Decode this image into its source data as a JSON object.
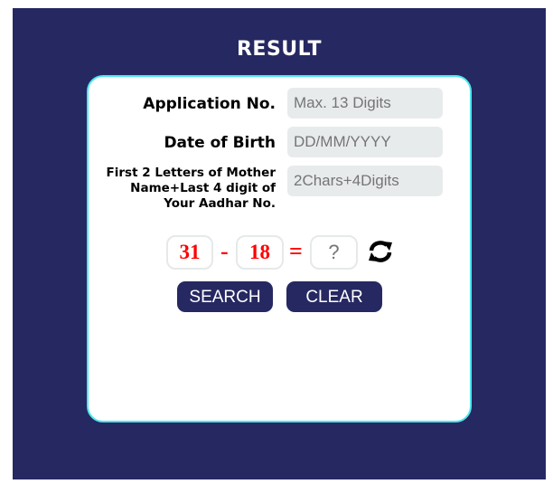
{
  "header": {
    "title": "RESULT"
  },
  "form": {
    "application_no": {
      "label": "Application No.",
      "placeholder": "Max. 13 Digits",
      "value": ""
    },
    "dob": {
      "label": "Date of Birth",
      "placeholder": "DD/MM/YYYY",
      "value": ""
    },
    "mother_aadhar": {
      "label": "First 2 Letters of Mother Name+Last 4 digit of Your Aadhar No.",
      "placeholder": "2Chars+4Digits",
      "value": ""
    }
  },
  "captcha": {
    "operand1": "31",
    "operator": "-",
    "operand2": "18",
    "equals": "=",
    "answer_placeholder": "?",
    "refresh_icon": "refresh-icon"
  },
  "buttons": {
    "search_label": "SEARCH",
    "clear_label": "CLEAR"
  },
  "colors": {
    "panel_bg": "#262862",
    "card_border": "#4ee6ee",
    "captcha_text": "#ff0000",
    "button_bg": "#262862"
  }
}
